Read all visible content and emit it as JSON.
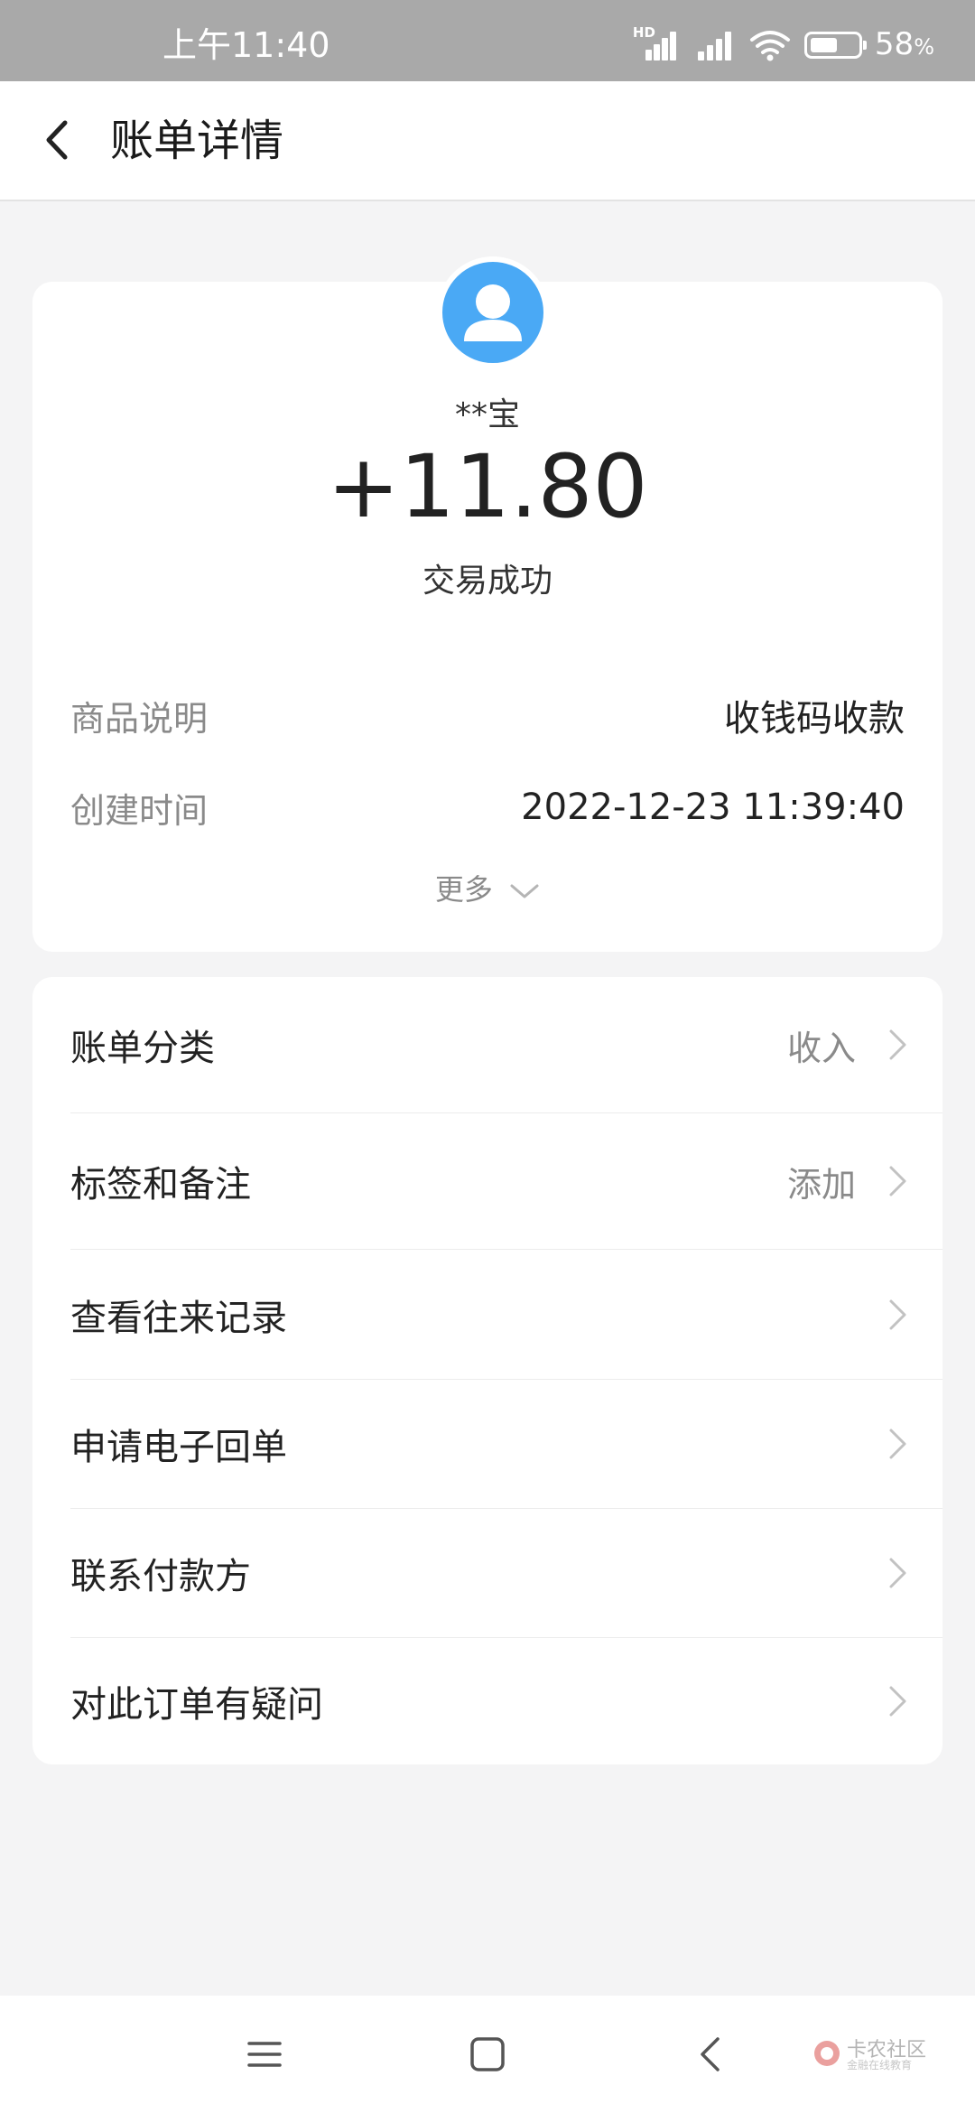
{
  "status_bar": {
    "time": "上午11:40",
    "battery_percent": "58",
    "battery_unit": "%",
    "battery_level": 0.58,
    "network_label": "HD",
    "icons": [
      "signal-hd-icon",
      "signal-icon",
      "wifi-icon",
      "battery-icon"
    ]
  },
  "header": {
    "title": "账单详情",
    "back_icon": "chevron-left-icon"
  },
  "summary": {
    "payer_name": "**宝",
    "amount": "+11.80",
    "status": "交易成功",
    "avatar_icon": "user-avatar-icon",
    "avatar_color": "#4aa9f5",
    "details": [
      {
        "label": "商品说明",
        "value": "收钱码收款"
      },
      {
        "label": "创建时间",
        "value": "2022-12-23 11:39:40"
      }
    ],
    "more_label": "更多",
    "more_icon": "chevron-down-icon"
  },
  "actions": [
    {
      "label": "账单分类",
      "value": "收入"
    },
    {
      "label": "标签和备注",
      "value": "添加"
    },
    {
      "label": "查看往来记录",
      "value": ""
    },
    {
      "label": "申请电子回单",
      "value": ""
    },
    {
      "label": "联系付款方",
      "value": ""
    },
    {
      "label": "对此订单有疑问",
      "value": ""
    }
  ],
  "nav_bar": {
    "icons": [
      "menu-icon",
      "home-icon",
      "back-icon"
    ],
    "watermark": "卡农社区",
    "watermark_sub": "金融在线教育"
  }
}
